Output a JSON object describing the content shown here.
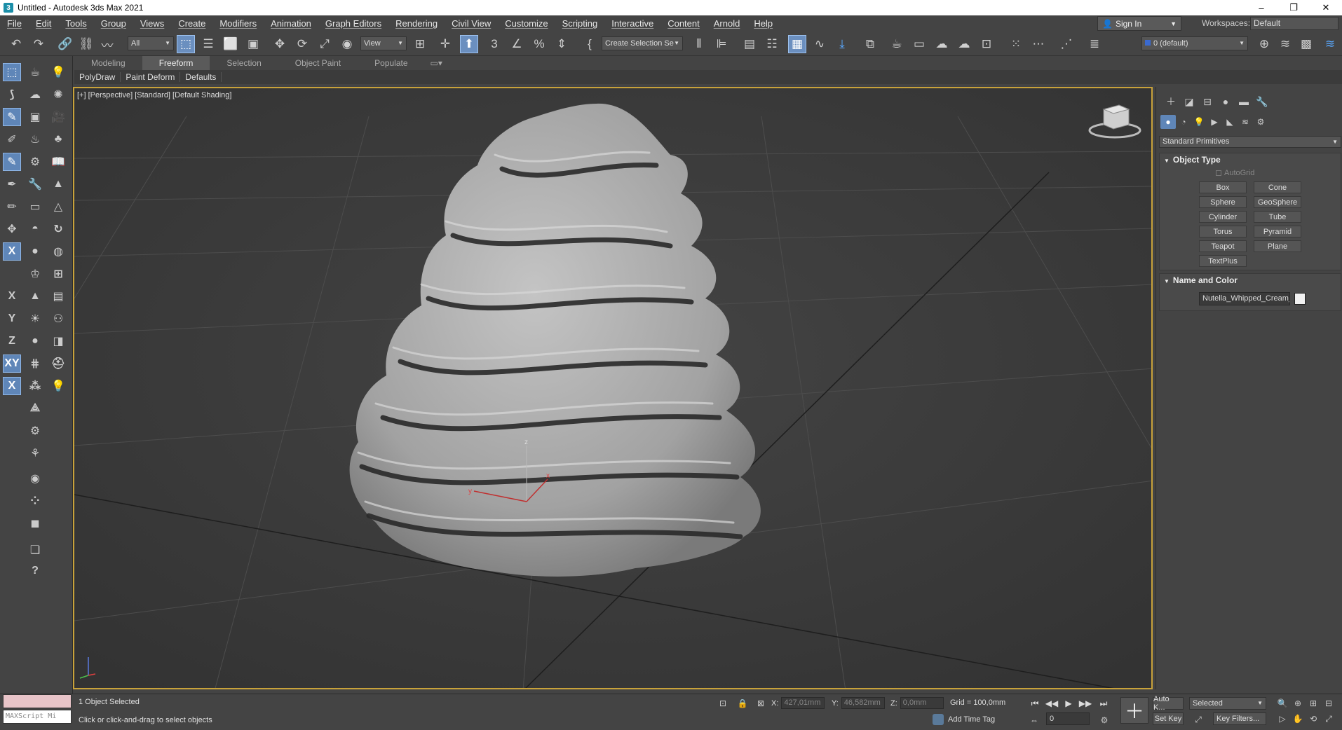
{
  "window": {
    "title": "Untitled - Autodesk 3ds Max 2021",
    "app_icon": "3",
    "minimize": "–",
    "restore": "❐",
    "close": "✕"
  },
  "menu": [
    "File",
    "Edit",
    "Tools",
    "Group",
    "Views",
    "Create",
    "Modifiers",
    "Animation",
    "Graph Editors",
    "Rendering",
    "Civil View",
    "Customize",
    "Scripting",
    "Interactive",
    "Content",
    "Arnold",
    "Help"
  ],
  "account": {
    "sign_in": "Sign In",
    "workspaces_label": "Workspaces:",
    "workspace": "Default"
  },
  "toolbar": {
    "selection_filter": "All",
    "ref_coord": "View",
    "named_selection": "Create Selection Se",
    "layer": "0 (default)"
  },
  "ribbon": {
    "tabs": [
      "Modeling",
      "Freeform",
      "Selection",
      "Object Paint",
      "Populate"
    ],
    "active_tab": "Freeform",
    "subtabs": [
      "PolyDraw",
      "Paint Deform",
      "Defaults"
    ]
  },
  "viewport": {
    "label": "[+] [Perspective] [Standard] [Default Shading]",
    "gizmo_axes": {
      "z": "z",
      "y": "y",
      "x": "x"
    },
    "object_color": "#a8a8a8",
    "border_color": "#c8a23a"
  },
  "command_panel": {
    "category": "Standard Primitives",
    "object_type_title": "Object Type",
    "autogrid": "AutoGrid",
    "primitives": [
      "Box",
      "Cone",
      "Sphere",
      "GeoSphere",
      "Cylinder",
      "Tube",
      "Torus",
      "Pyramid",
      "Teapot",
      "Plane",
      "TextPlus"
    ],
    "name_color_title": "Name and Color",
    "object_name": "Nutella_Whipped_Cream_",
    "object_color": "#f2f2f2"
  },
  "status": {
    "maxscript_placeholder": "MAXScript Mi",
    "selected_count": "1 Object Selected",
    "prompt": "Click or click-and-drag to select objects",
    "x_label": "X:",
    "x": "427,01mm",
    "y_label": "Y:",
    "y": "46,582mm",
    "z_label": "Z:",
    "z": "0,0mm",
    "grid": "Grid = 100,0mm",
    "add_time_tag": "Add Time Tag",
    "frame": "0",
    "auto_key": "Auto K...",
    "set_key": "Set Key",
    "key_mode": "Selected",
    "key_filters": "Key Filters..."
  }
}
